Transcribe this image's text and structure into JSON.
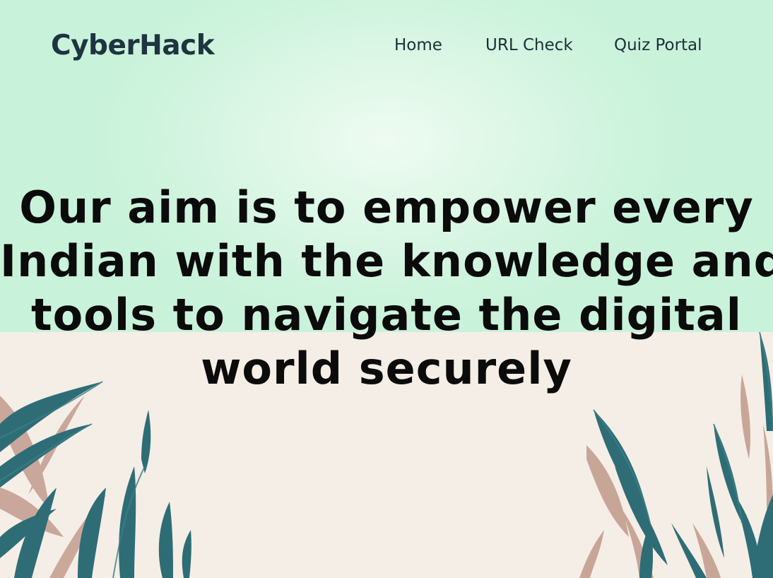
{
  "brand": {
    "name": "CyberHack"
  },
  "nav": {
    "items": [
      {
        "label": "Home"
      },
      {
        "label": "URL Check"
      },
      {
        "label": "Quiz Portal"
      }
    ]
  },
  "hero": {
    "lines": [
      "Our aim is to empower every",
      "Indian with the knowledge and",
      "tools to navigate the digital",
      "world securely"
    ]
  },
  "colors": {
    "mint_background": "#c9f2da",
    "cream_background": "#f5eee6",
    "leaf_teal": "#2f6f78",
    "leaf_dusty_rose": "#c8a89a"
  },
  "decor": {
    "left_leaves_icon": "palm-leaves-icon",
    "right_leaves_icon": "palm-leaves-icon"
  }
}
